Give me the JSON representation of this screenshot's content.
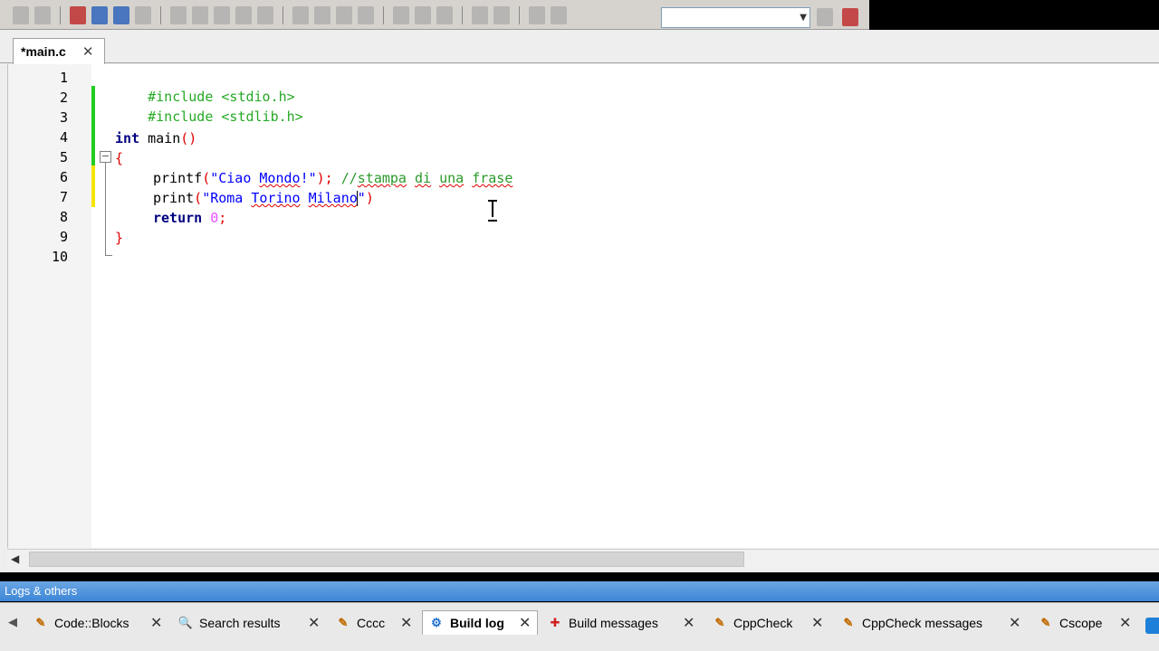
{
  "editor": {
    "tab_label": "*main.c",
    "tab_close": "✕",
    "line_numbers": [
      "1",
      "2",
      "3",
      "4",
      "5",
      "6",
      "7",
      "8",
      "9",
      "10"
    ],
    "code": {
      "l1": "#include <stdio.h>",
      "l2": "#include <stdlib.h>",
      "l4_kw": "int",
      "l4_rest": " main",
      "l4_paren": "()",
      "l5": "{",
      "l6_fn": "printf",
      "l6_p1": "(",
      "l6_q": "\"Ciao ",
      "l6_w": "Mondo",
      "l6_q2": "!\"",
      "l6_p2": ");",
      "l6_cmt1": " //",
      "l6_cmt_w1": "stampa",
      "l6_cmt_sp1": " ",
      "l6_cmt_w2": "di",
      "l6_cmt_sp2": " ",
      "l6_cmt_w3": "una",
      "l6_cmt_sp3": " ",
      "l6_cmt_w4": "frase",
      "l7_fn": "print",
      "l7_p1": "(",
      "l7_s1": "\"Roma ",
      "l7_w1": "Torino",
      "l7_sp": " ",
      "l7_w2": "Milano",
      "l7_q": "\"",
      "l7_p2": ")",
      "l8_kw": "return",
      "l8_sp": " ",
      "l8_num": "0",
      "l8_end": ";",
      "l9": "}"
    }
  },
  "logs": {
    "header": "Logs & others",
    "tabs": [
      {
        "label": "Code::Blocks",
        "icon": "pencil-icon"
      },
      {
        "label": "Search results",
        "icon": "search-icon"
      },
      {
        "label": "Cccc",
        "icon": "pencil-icon"
      },
      {
        "label": "Build log",
        "icon": "gear-icon"
      },
      {
        "label": "Build messages",
        "icon": "bug-icon"
      },
      {
        "label": "CppCheck",
        "icon": "pencil-icon"
      },
      {
        "label": "CppCheck messages",
        "icon": "pencil-icon"
      },
      {
        "label": "Cscope",
        "icon": "pencil-icon"
      }
    ],
    "close_glyph": "✕"
  },
  "colors": {
    "preprocessor": "#26a926",
    "keyword": "#000080",
    "string": "#0000ff",
    "number": "#e64dff",
    "comment": "#2a9a2a",
    "operator": "#e00000",
    "logs_header": "#3d86d6"
  }
}
